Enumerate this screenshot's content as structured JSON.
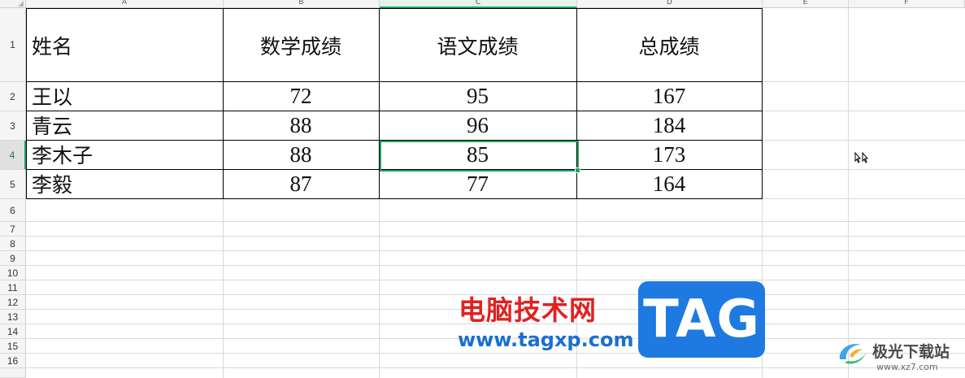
{
  "sheet": {
    "columns": [
      "A",
      "B",
      "C",
      "D",
      "E",
      "F"
    ],
    "active_column": "C",
    "rows": [
      "1",
      "2",
      "3",
      "4",
      "5",
      "6",
      "7",
      "8",
      "9",
      "10",
      "11",
      "12",
      "13",
      "14",
      "15",
      "16"
    ],
    "active_row": "4",
    "table": {
      "headers": [
        "姓名",
        "数学成绩",
        "语文成绩",
        "总成绩"
      ],
      "records": [
        {
          "name": "王以",
          "math": "72",
          "chinese": "95",
          "total": "167"
        },
        {
          "name": "青云",
          "math": "88",
          "chinese": "96",
          "total": "184"
        },
        {
          "name": "李木子",
          "math": "88",
          "chinese": "85",
          "total": "173"
        },
        {
          "name": "李毅",
          "math": "87",
          "chinese": "77",
          "total": "164"
        }
      ]
    },
    "selected_cell": "C4"
  },
  "watermarks": {
    "site_title": "电脑技术网",
    "site_url": "www.tagxp.com",
    "tag_logo": "TAG",
    "xz7_title": "极光下载站",
    "xz7_url": "www.xz7.com"
  },
  "colors": {
    "selection": "#21a366",
    "grid": "#d9d9d9",
    "table_border": "#000000",
    "watermark_red": "#e02222",
    "watermark_blue": "#1a6fd1",
    "tag_bg": "#1e7ae0"
  },
  "icons": {
    "cursor": "move-cursor-icon",
    "xz7_logo": "aurora-swirl-logo-icon"
  }
}
